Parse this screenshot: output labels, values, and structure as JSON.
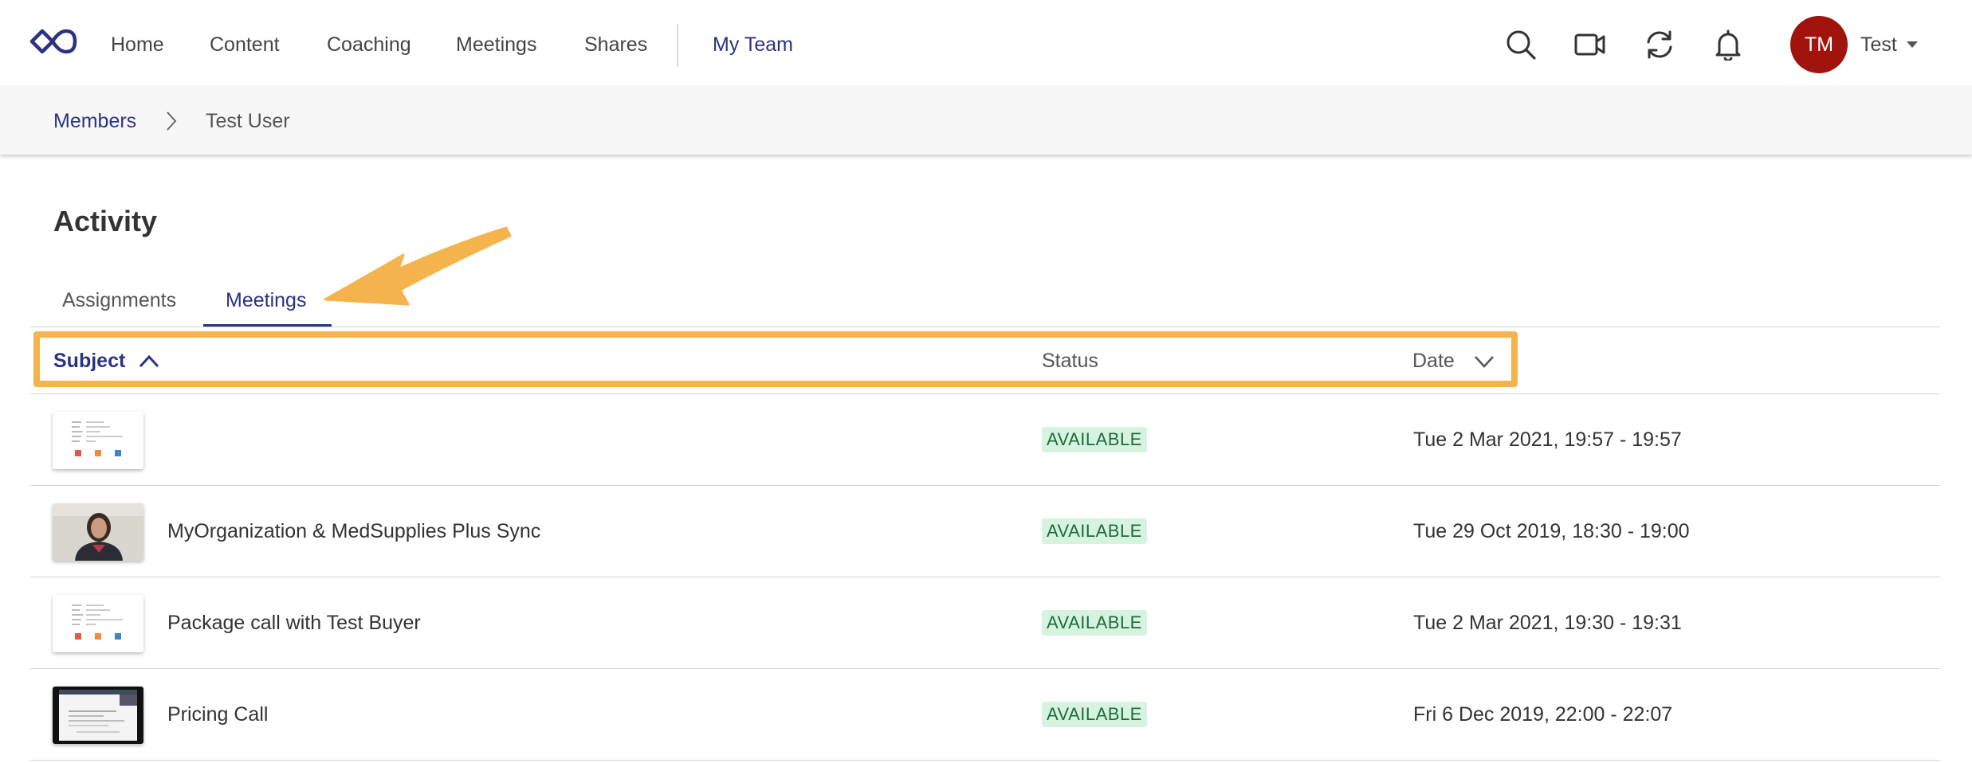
{
  "nav": {
    "items": [
      {
        "label": "Home"
      },
      {
        "label": "Content"
      },
      {
        "label": "Coaching"
      },
      {
        "label": "Meetings"
      },
      {
        "label": "Shares"
      },
      {
        "label": "My Team"
      }
    ],
    "active": "My Team",
    "icons": [
      "search-icon",
      "video-camera-icon",
      "sync-icon",
      "bell-icon"
    ],
    "user": {
      "initials": "TM",
      "name": "Test",
      "avatar_color": "#a1130d"
    }
  },
  "breadcrumb": {
    "parent": "Members",
    "current": "Test User"
  },
  "page": {
    "title": "Activity",
    "tabs": [
      {
        "label": "Assignments"
      },
      {
        "label": "Meetings"
      }
    ],
    "active_tab": "Meetings"
  },
  "table": {
    "headers": {
      "subject": "Subject",
      "status": "Status",
      "date": "Date"
    },
    "sort": {
      "column": "Subject",
      "direction": "ascending"
    },
    "rows": [
      {
        "thumbnail": "document-thumbnail",
        "subject": "",
        "status": "AVAILABLE",
        "date": "Tue 2 Mar 2021, 19:57 - 19:57"
      },
      {
        "thumbnail": "person-video-thumbnail",
        "subject": "MyOrganization & MedSupplies Plus Sync",
        "status": "AVAILABLE",
        "date": "Tue 29 Oct 2019, 18:30 - 19:00"
      },
      {
        "thumbnail": "document-thumbnail",
        "subject": "Package call with Test Buyer",
        "status": "AVAILABLE",
        "date": "Tue 2 Mar 2021, 19:30 - 19:31"
      },
      {
        "thumbnail": "screen-share-thumbnail",
        "subject": "Pricing Call",
        "status": "AVAILABLE",
        "date": "Fri 6 Dec 2019, 22:00 - 22:07"
      }
    ]
  },
  "colors": {
    "brand": "#2b3380",
    "status_bg": "#d6f3e0",
    "status_text": "#1d6b3b",
    "annotation": "#f4b34c"
  }
}
